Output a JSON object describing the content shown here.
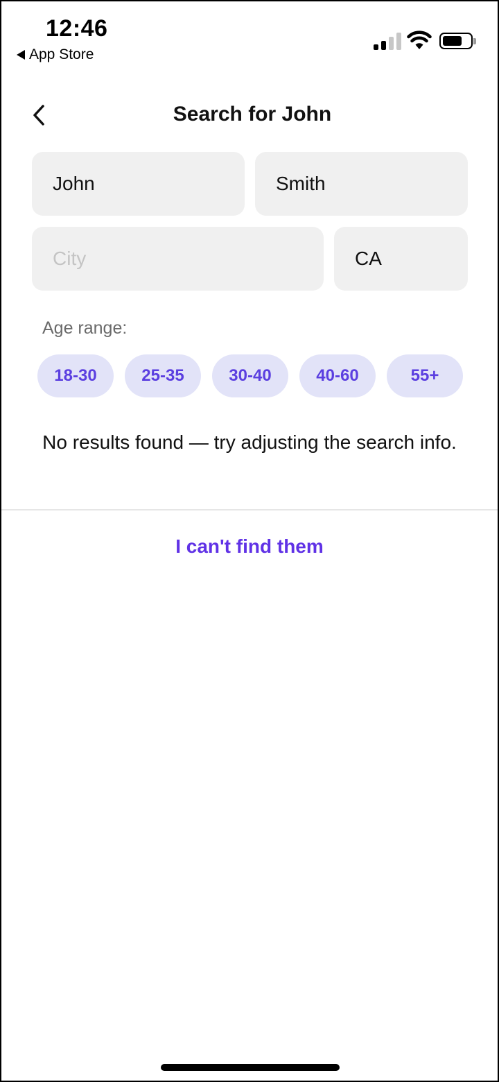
{
  "status_bar": {
    "time": "12:46",
    "back_app_label": "App Store",
    "signal_icon": "cellular-signal-icon",
    "wifi_icon": "wifi-icon",
    "battery_icon": "battery-icon",
    "battery_level": 0.7
  },
  "header": {
    "title": "Search for John",
    "back_icon": "chevron-left-icon"
  },
  "form": {
    "first_name": {
      "value": "John",
      "placeholder": ""
    },
    "last_name": {
      "value": "Smith",
      "placeholder": ""
    },
    "city": {
      "value": "",
      "placeholder": "City"
    },
    "state": {
      "value": "CA",
      "placeholder": ""
    }
  },
  "age_range": {
    "label": "Age range:",
    "options": [
      "18-30",
      "25-35",
      "30-40",
      "40-60",
      "55+"
    ]
  },
  "results": {
    "message": "No results found — try adjusting the search info."
  },
  "actions": {
    "cant_find_label": "I can't find them"
  },
  "colors": {
    "accent": "#6032e6",
    "chip_bg": "#e2e3f8",
    "field_bg": "#f0f0f0"
  }
}
